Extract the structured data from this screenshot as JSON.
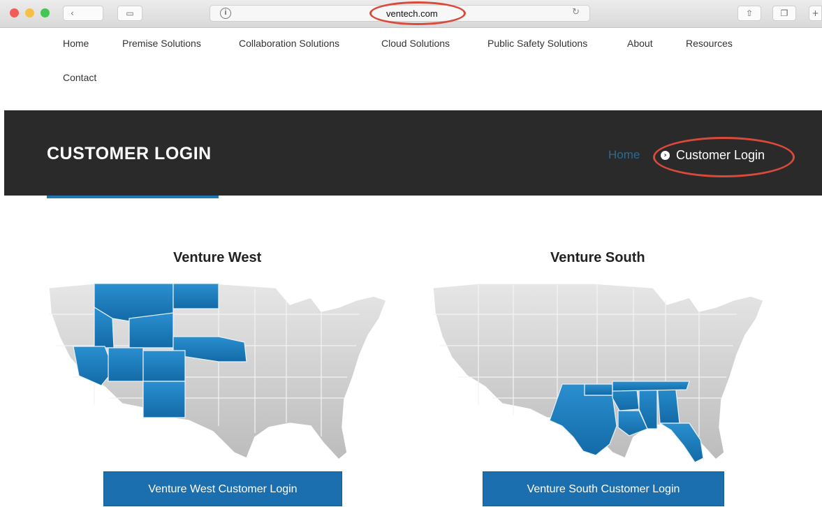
{
  "browser": {
    "url": "ventech.com",
    "back_icon": "‹",
    "sidebar_icon": "▭",
    "info_icon": "i",
    "reload_icon": "↻",
    "share_icon": "⇧",
    "tabs_icon": "❐",
    "plus_icon": "+"
  },
  "nav": {
    "items": [
      "Home",
      "Premise Solutions",
      "Collaboration Solutions",
      "Cloud Solutions",
      "Public Safety Solutions",
      "About",
      "Resources",
      "Contact"
    ]
  },
  "banner": {
    "title": "CUSTOMER LOGIN",
    "breadcrumb_home": "Home",
    "breadcrumb_separator": "›",
    "breadcrumb_current": "Customer Login"
  },
  "regions": [
    {
      "title": "Venture West",
      "button": "Venture West Customer Login"
    },
    {
      "title": "Venture South",
      "button": "Venture South Customer Login"
    }
  ],
  "colors": {
    "highlight_state": "#1f78b4",
    "gray_state": "#d0d0d0",
    "button": "#1c6fae",
    "annotation": "#d94a3a"
  }
}
